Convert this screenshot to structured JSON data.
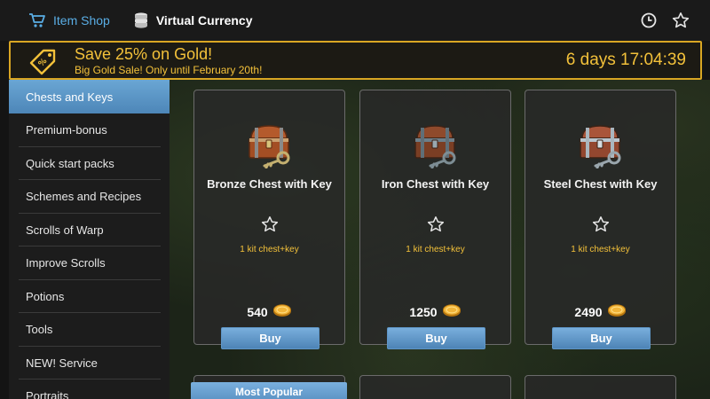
{
  "header": {
    "tabs": [
      {
        "label": "Item Shop",
        "icon": "cart-icon"
      },
      {
        "label": "Virtual Currency",
        "icon": "coins-stack-icon"
      }
    ],
    "right_icons": [
      "clock-icon",
      "star-icon"
    ]
  },
  "banner": {
    "title": "Save 25% on Gold!",
    "subtitle": "Big Gold Sale! Only until February 20th!",
    "timer": "6 days 17:04:39",
    "icon": "discount-tag-icon",
    "accent_color": "#f3c13a"
  },
  "sidebar": {
    "items": [
      {
        "label": "Chests and Keys",
        "active": true
      },
      {
        "label": "Premium-bonus"
      },
      {
        "label": "Quick start packs"
      },
      {
        "label": "Schemes and Recipes"
      },
      {
        "label": "Scrolls of Warp"
      },
      {
        "label": "Improve Scrolls"
      },
      {
        "label": "Potions"
      },
      {
        "label": "Tools"
      },
      {
        "label": "NEW! Service"
      },
      {
        "label": "Portraits"
      }
    ],
    "active_color": "#5a96c9"
  },
  "products": [
    {
      "name": "Bronze Chest with Key",
      "note": "1 kit chest+key",
      "price": "540",
      "buy_label": "Buy",
      "icon": "bronze-chest-icon"
    },
    {
      "name": "Iron Chest with Key",
      "note": "1 kit chest+key",
      "price": "1250",
      "buy_label": "Buy",
      "icon": "iron-chest-icon"
    },
    {
      "name": "Steel Chest with Key",
      "note": "1 kit chest+key",
      "price": "2490",
      "buy_label": "Buy",
      "icon": "steel-chest-icon"
    }
  ],
  "popular_label": "Most Popular"
}
